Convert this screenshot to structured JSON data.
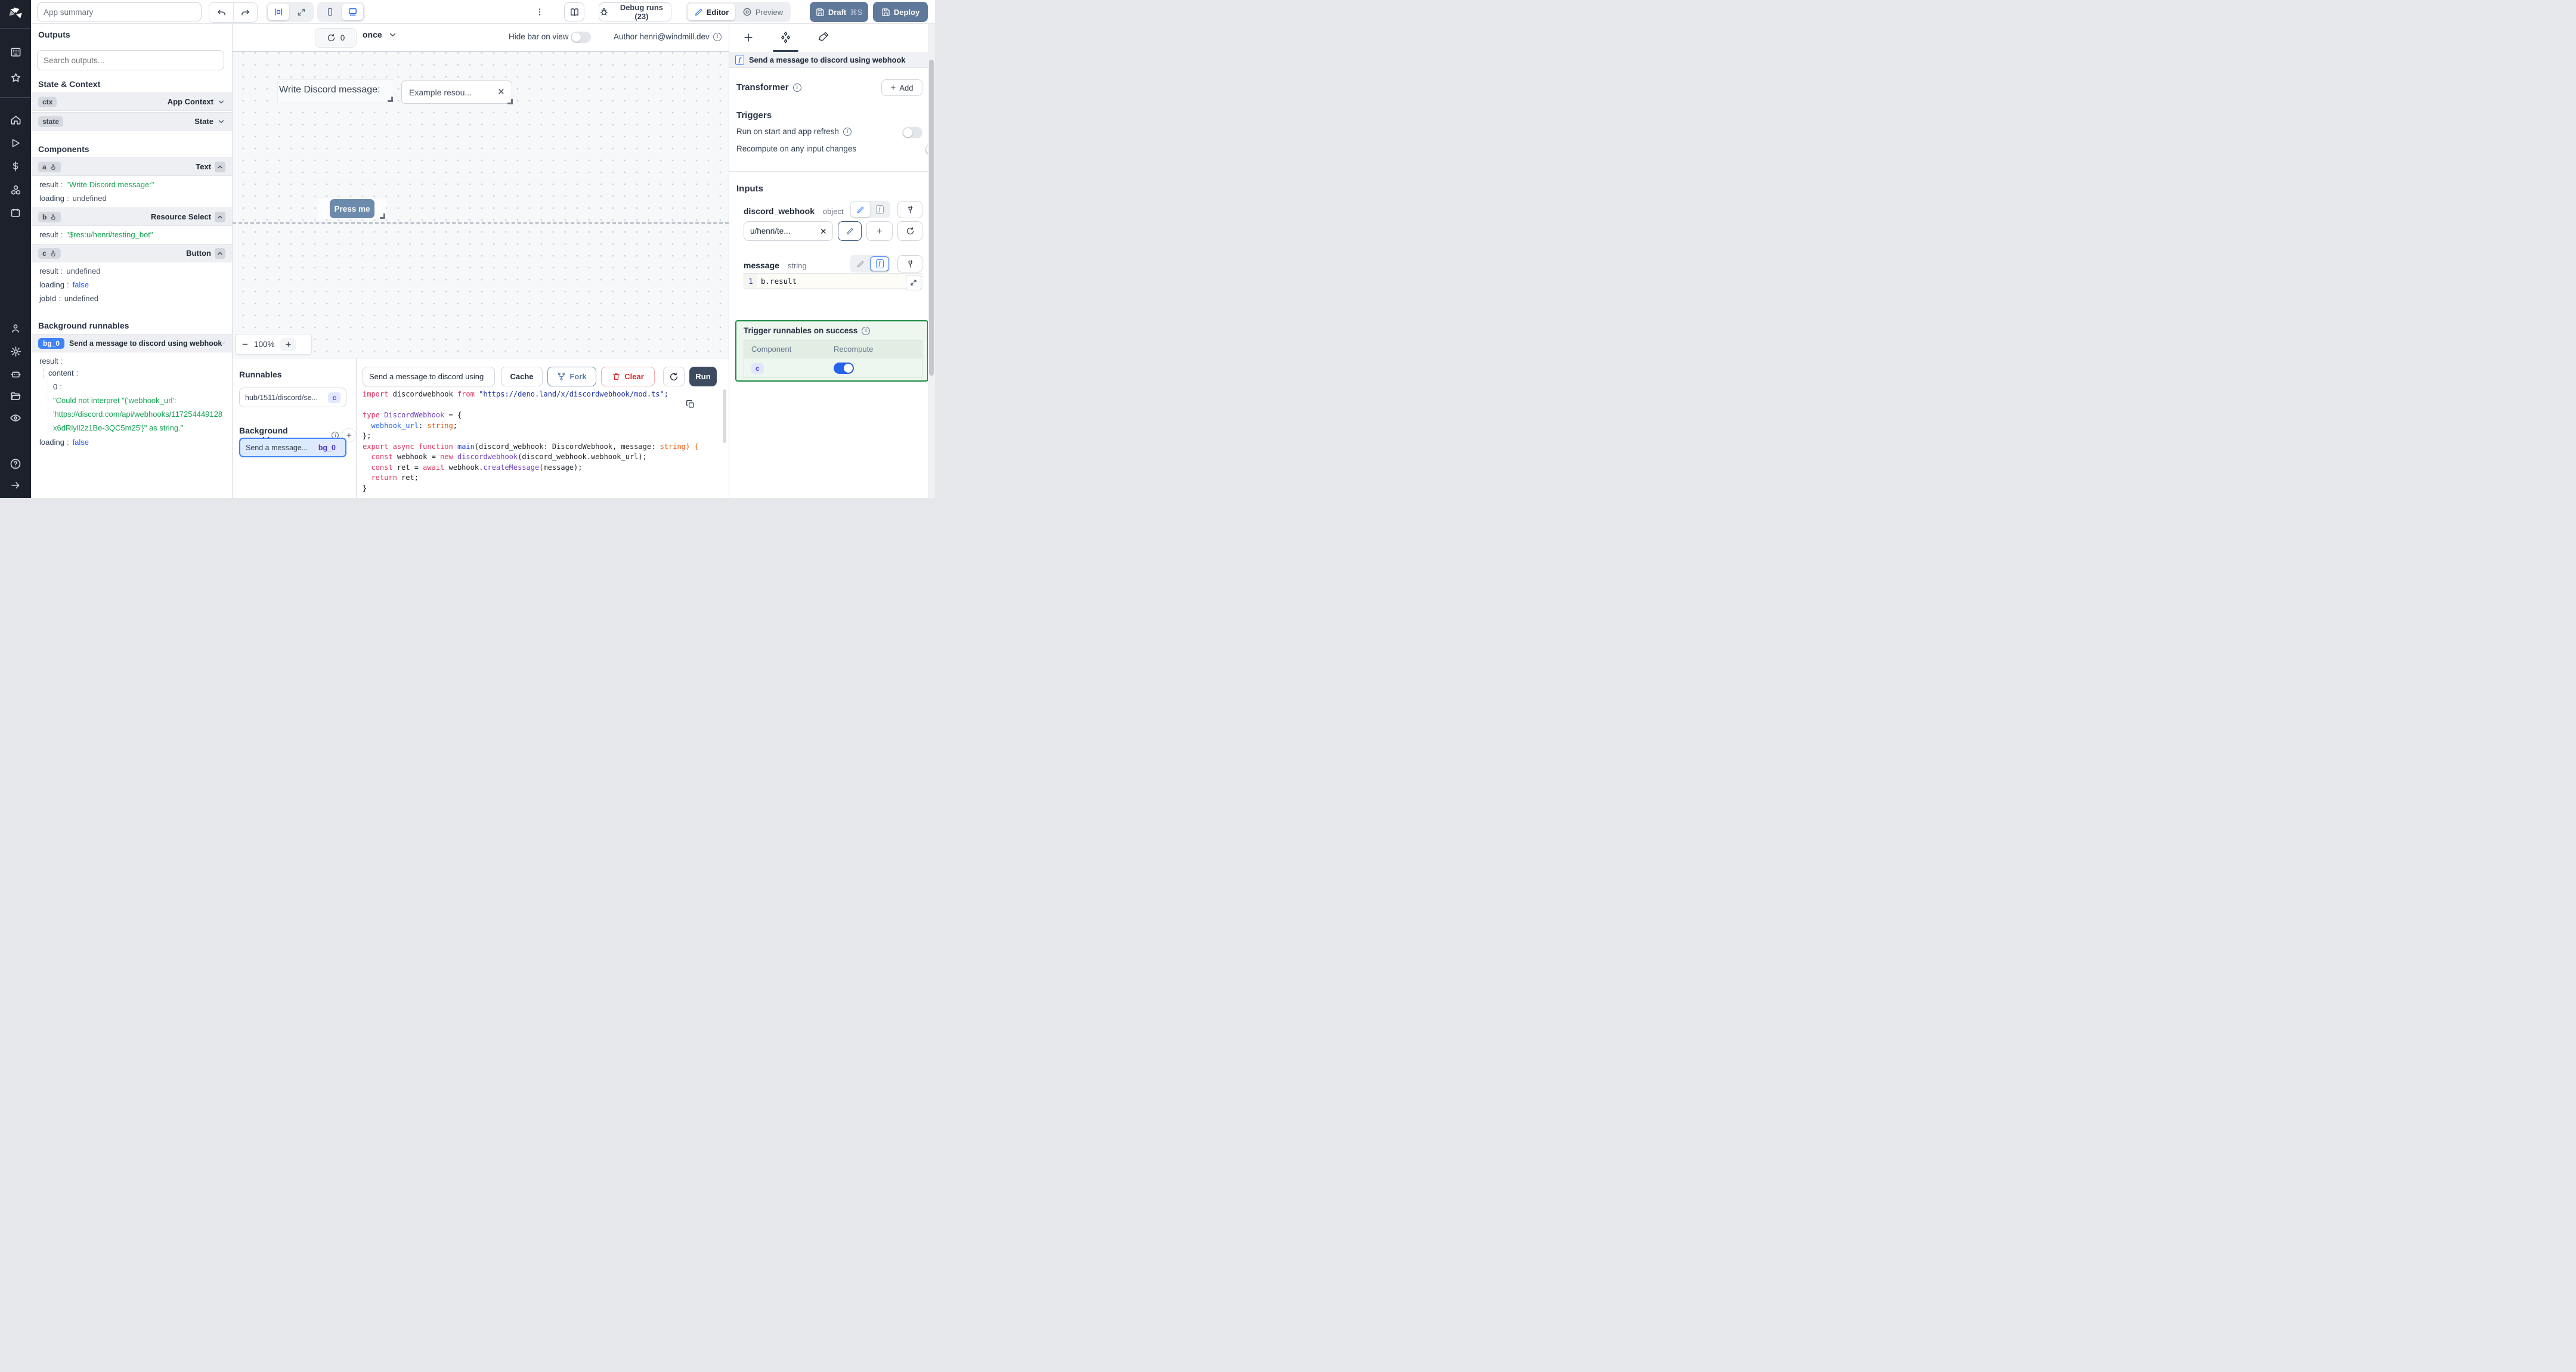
{
  "topbar": {
    "app_summary_placeholder": "App summary",
    "debug_runs": "Debug runs (23)",
    "editor": "Editor",
    "preview": "Preview",
    "draft": "Draft",
    "draft_shortcut": "⌘S",
    "deploy": "Deploy"
  },
  "outputs": {
    "title": "Outputs",
    "search_placeholder": "Search outputs...",
    "state_context_title": "State & Context",
    "ctx_key": "ctx",
    "ctx_label": "App Context",
    "state_key": "state",
    "state_label": "State",
    "components_title": "Components",
    "comp_a": {
      "id": "a",
      "type": "Text",
      "p1k": "result",
      "p1v": "\"Write Discord message:\"",
      "p2k": "loading",
      "p2v": "undefined"
    },
    "comp_b": {
      "id": "b",
      "type": "Resource Select",
      "p1k": "result",
      "p1v": "\"$res:u/henri/testing_bot\""
    },
    "comp_c": {
      "id": "c",
      "type": "Button",
      "p1k": "result",
      "p1v": "undefined",
      "p2k": "loading",
      "p2v": "false",
      "p3k": "jobId",
      "p3v": "undefined"
    },
    "background_title": "Background runnables",
    "bg": {
      "id": "bg_0",
      "label": "Send a message to discord using webhook",
      "result_key": "result",
      "content_key": "content",
      "index_key": "0",
      "error_line1": "\"Could not interpret \"{'webhook_url':",
      "error_line2": "'https://discord.com/api/webhooks/117254449128",
      "error_line3": "x6dRlyll2z1Be-3QC5m25'}\" as string.\"",
      "loading_key": "loading",
      "loading_val": "false"
    }
  },
  "canvas": {
    "refresh_count": "0",
    "frequency": "once",
    "hide_bar_label": "Hide bar on view",
    "author_label": "Author henri@windmill.dev",
    "text_component": "Write Discord message:",
    "select_value": "Example resou...",
    "button_label": "Press me",
    "zoom_level": "100%",
    "zoom_minus": "−",
    "zoom_plus": "+"
  },
  "runnables": {
    "title": "Runnables",
    "item_path": "hub/1511/discord/se...",
    "item_badge": "c",
    "background_title": "Background runnables",
    "bg_label": "Send a message...",
    "bg_badge": "bg_0"
  },
  "editor": {
    "script_name": "Send a message to discord using",
    "cache": "Cache",
    "fork": "Fork",
    "clear": "Clear",
    "run": "Run",
    "code": [
      [
        [
          "import",
          "kw"
        ],
        [
          " discordwebhook ",
          "id"
        ],
        [
          "from",
          "kw"
        ],
        [
          " ",
          "id"
        ],
        [
          "\"https://deno.land/x/discordwebhook/mod.ts\";",
          "str"
        ]
      ],
      [],
      [
        [
          "type",
          "kw"
        ],
        [
          " ",
          "id"
        ],
        [
          "DiscordWebhook",
          "type"
        ],
        [
          " = {",
          "id"
        ]
      ],
      [
        [
          "  ",
          "id"
        ],
        [
          "webhook_url",
          "prop"
        ],
        [
          ": ",
          "id"
        ],
        [
          "string",
          "orange"
        ],
        [
          ";",
          "id"
        ]
      ],
      [
        [
          "};",
          "id"
        ]
      ],
      [
        [
          "export",
          "kw"
        ],
        [
          " ",
          "id"
        ],
        [
          "async",
          "kw"
        ],
        [
          " ",
          "id"
        ],
        [
          "function",
          "kw"
        ],
        [
          " ",
          "id"
        ],
        [
          "main",
          "fn"
        ],
        [
          "(discord_webhook: DiscordWebhook, message: ",
          "id"
        ],
        [
          "string) {",
          "orange"
        ]
      ],
      [
        [
          "  ",
          "id"
        ],
        [
          "const",
          "kw"
        ],
        [
          " webhook = ",
          "id"
        ],
        [
          "new",
          "kw"
        ],
        [
          " ",
          "id"
        ],
        [
          "discordwebhook",
          "type"
        ],
        [
          "(discord_webhook.webhook_url);",
          "id"
        ]
      ],
      [
        [
          "  ",
          "id"
        ],
        [
          "const",
          "kw"
        ],
        [
          " ret = ",
          "id"
        ],
        [
          "await",
          "kw"
        ],
        [
          " webhook.",
          "id"
        ],
        [
          "createMessage",
          "type"
        ],
        [
          "(message);",
          "id"
        ]
      ],
      [
        [
          "  ",
          "id"
        ],
        [
          "return",
          "kw"
        ],
        [
          " ret;",
          "id"
        ]
      ],
      [
        [
          "}",
          "id"
        ]
      ]
    ]
  },
  "panel": {
    "header": "Send a message to discord using webhook",
    "transformer_title": "Transformer",
    "add_label": "Add",
    "triggers_title": "Triggers",
    "trigger1": "Run on start and app refresh",
    "trigger2": "Recompute on any input changes",
    "inputs_title": "Inputs",
    "input1_name": "discord_webhook",
    "input1_type": "object",
    "input1_value": "u/henri/te...",
    "input2_name": "message",
    "input2_type": "string",
    "code_line_no": "1",
    "code_value": "b.result",
    "success_title": "Trigger runnables on success",
    "col_component": "Component",
    "col_recompute": "Recompute",
    "row_component": "c"
  }
}
